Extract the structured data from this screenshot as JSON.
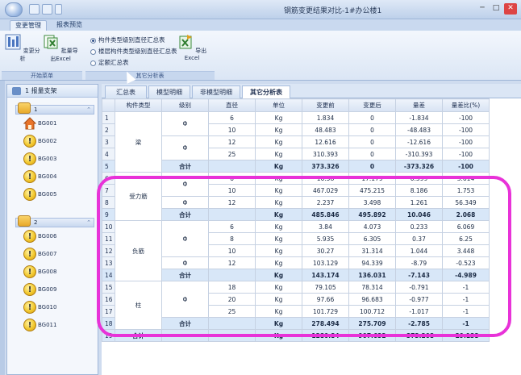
{
  "window": {
    "title": "钢筋变更结果对比-1#办公楼1"
  },
  "ribbon": {
    "tabs": [
      "变更管理",
      "报表预览"
    ],
    "active_tab": 0,
    "buttons": {
      "change_analysis": "变更分析",
      "batch_export": "批量导出Excel",
      "export_excel": "导出Excel"
    },
    "radios": [
      {
        "label": "构件类型级别直径汇总表",
        "selected": true
      },
      {
        "label": "楼层构件类型级别直径汇总表",
        "selected": false
      },
      {
        "label": "定额汇总表",
        "selected": false
      }
    ],
    "group_labels": {
      "start": "开始菜单",
      "other": "其它分析表"
    }
  },
  "left_panel": {
    "header": "1 报量支架",
    "groups": [
      {
        "label": "1",
        "items": [
          "BG001",
          "BG002",
          "BG003",
          "BG004",
          "BG005"
        ]
      },
      {
        "label": "2",
        "items": [
          "BG006",
          "BG007",
          "BG008",
          "BG009",
          "BG010",
          "BG011"
        ]
      }
    ]
  },
  "content_tabs": [
    "汇总表",
    "模型明细",
    "非模型明细",
    "其它分析表"
  ],
  "active_content_tab": 3,
  "table": {
    "columns": [
      "",
      "构件类型",
      "级别",
      "直径",
      "单位",
      "变更前",
      "变更后",
      "量差",
      "量差比(%)"
    ],
    "rows": [
      {
        "n": "1",
        "type": "梁",
        "grade": "Φ",
        "dia": "6",
        "unit": "Kg",
        "before": "1.834",
        "after": "0",
        "diff": "-1.834",
        "ratio": "-100"
      },
      {
        "n": "2",
        "type": "",
        "grade": "",
        "dia": "10",
        "unit": "Kg",
        "before": "48.483",
        "after": "0",
        "diff": "-48.483",
        "ratio": "-100"
      },
      {
        "n": "3",
        "type": "",
        "grade": "Φ",
        "dia": "12",
        "unit": "Kg",
        "before": "12.616",
        "after": "0",
        "diff": "-12.616",
        "ratio": "-100"
      },
      {
        "n": "4",
        "type": "",
        "grade": "",
        "dia": "25",
        "unit": "Kg",
        "before": "310.393",
        "after": "0",
        "diff": "-310.393",
        "ratio": "-100"
      },
      {
        "n": "5",
        "type": "",
        "grade": "合计",
        "dia": "",
        "unit": "Kg",
        "before": "373.326",
        "after": "0",
        "diff": "-373.326",
        "ratio": "-100",
        "total": true
      },
      {
        "n": "6",
        "type": "受力筋",
        "grade": "Φ",
        "dia": "6",
        "unit": "Kg",
        "before": "16.58",
        "after": "17.179",
        "diff": "0.599",
        "ratio": "3.614"
      },
      {
        "n": "7",
        "type": "",
        "grade": "",
        "dia": "10",
        "unit": "Kg",
        "before": "467.029",
        "after": "475.215",
        "diff": "8.186",
        "ratio": "1.753"
      },
      {
        "n": "8",
        "type": "",
        "grade": "Φ",
        "dia": "12",
        "unit": "Kg",
        "before": "2.237",
        "after": "3.498",
        "diff": "1.261",
        "ratio": "56.349"
      },
      {
        "n": "9",
        "type": "",
        "grade": "合计",
        "dia": "",
        "unit": "Kg",
        "before": "485.846",
        "after": "495.892",
        "diff": "10.046",
        "ratio": "2.068",
        "total": true
      },
      {
        "n": "10",
        "type": "负筋",
        "grade": "Φ",
        "dia": "6",
        "unit": "Kg",
        "before": "3.84",
        "after": "4.073",
        "diff": "0.233",
        "ratio": "6.069"
      },
      {
        "n": "11",
        "type": "",
        "grade": "",
        "dia": "8",
        "unit": "Kg",
        "before": "5.935",
        "after": "6.305",
        "diff": "0.37",
        "ratio": "6.25"
      },
      {
        "n": "12",
        "type": "",
        "grade": "",
        "dia": "10",
        "unit": "Kg",
        "before": "30.27",
        "after": "31.314",
        "diff": "1.044",
        "ratio": "3.448"
      },
      {
        "n": "13",
        "type": "",
        "grade": "Φ",
        "dia": "12",
        "unit": "Kg",
        "before": "103.129",
        "after": "94.339",
        "diff": "-8.79",
        "ratio": "-0.523"
      },
      {
        "n": "14",
        "type": "",
        "grade": "合计",
        "dia": "",
        "unit": "Kg",
        "before": "143.174",
        "after": "136.031",
        "diff": "-7.143",
        "ratio": "-4.989",
        "total": true
      },
      {
        "n": "15",
        "type": "柱",
        "grade": "Φ",
        "dia": "18",
        "unit": "Kg",
        "before": "79.105",
        "after": "78.314",
        "diff": "-0.791",
        "ratio": "-1"
      },
      {
        "n": "16",
        "type": "",
        "grade": "",
        "dia": "20",
        "unit": "Kg",
        "before": "97.66",
        "after": "96.683",
        "diff": "-0.977",
        "ratio": "-1"
      },
      {
        "n": "17",
        "type": "",
        "grade": "",
        "dia": "25",
        "unit": "Kg",
        "before": "101.729",
        "after": "100.712",
        "diff": "-1.017",
        "ratio": "-1"
      },
      {
        "n": "18",
        "type": "",
        "grade": "合计",
        "dia": "",
        "unit": "Kg",
        "before": "278.494",
        "after": "275.709",
        "diff": "-2.785",
        "ratio": "-1",
        "total": true
      },
      {
        "n": "19",
        "type": "合计",
        "grade": "",
        "dia": "",
        "unit": "Kg",
        "before": "1280.84",
        "after": "907.632",
        "diff": "-373.208",
        "ratio": "-29.138",
        "total": true
      }
    ]
  },
  "colors": {
    "highlight": "#e832d8",
    "total_row": "#d8e7f8"
  }
}
